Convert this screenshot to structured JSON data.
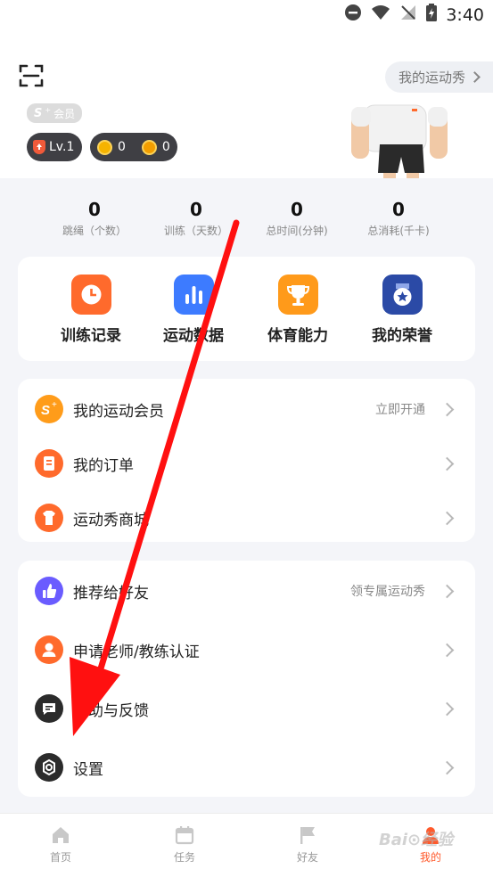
{
  "status_bar": {
    "time": "3:40"
  },
  "header": {
    "show_button_label": "我的运动秀"
  },
  "profile": {
    "vip_badge_text": "会员",
    "vip_s": "S",
    "level": "Lv.1",
    "coins_gold": "0",
    "coins_silver": "0"
  },
  "stats": [
    {
      "value": "0",
      "label": "跳绳（个数）"
    },
    {
      "value": "0",
      "label": "训练（天数）"
    },
    {
      "value": "0",
      "label": "总时间(分钟)"
    },
    {
      "value": "0",
      "label": "总消耗(千卡)"
    }
  ],
  "quick_actions": [
    {
      "label": "训练记录",
      "icon": "clock-icon",
      "color": "#ff6a2c"
    },
    {
      "label": "运动数据",
      "icon": "bar-chart-icon",
      "color": "#3d7bff"
    },
    {
      "label": "体育能力",
      "icon": "trophy-icon",
      "color": "#ff9a1a"
    },
    {
      "label": "我的荣誉",
      "icon": "medal-icon",
      "color": "#2b4aa6"
    }
  ],
  "menu_group_1": [
    {
      "label": "我的运动会员",
      "right_text": "立即开通",
      "icon": "vip-s-icon",
      "color": "#ff9c1a"
    },
    {
      "label": "我的订单",
      "right_text": "",
      "icon": "order-icon",
      "color": "#ff6a2c"
    },
    {
      "label": "运动秀商城",
      "right_text": "",
      "icon": "shop-icon",
      "color": "#ff6a2c"
    }
  ],
  "menu_group_2": [
    {
      "label": "推荐给好友",
      "right_text": "领专属运动秀",
      "icon": "thumbs-up-icon",
      "color": "#6a5cff"
    },
    {
      "label": "申请老师/教练认证",
      "right_text": "",
      "icon": "user-icon",
      "color": "#ff6a2c"
    },
    {
      "label": "帮助与反馈",
      "right_text": "",
      "icon": "chat-icon",
      "color": "#2b2b2b"
    },
    {
      "label": "设置",
      "right_text": "",
      "icon": "gear-icon",
      "color": "#2b2b2b"
    }
  ],
  "tabbar": [
    {
      "label": "首页",
      "icon": "home-icon",
      "active": false
    },
    {
      "label": "任务",
      "icon": "calendar-icon",
      "active": false
    },
    {
      "label": "好友",
      "icon": "flag-icon",
      "active": false
    },
    {
      "label": "我的",
      "icon": "profile-icon",
      "active": true
    }
  ],
  "colors": {
    "accent": "#ff5a2c",
    "annotation_arrow": "#ff1010"
  }
}
